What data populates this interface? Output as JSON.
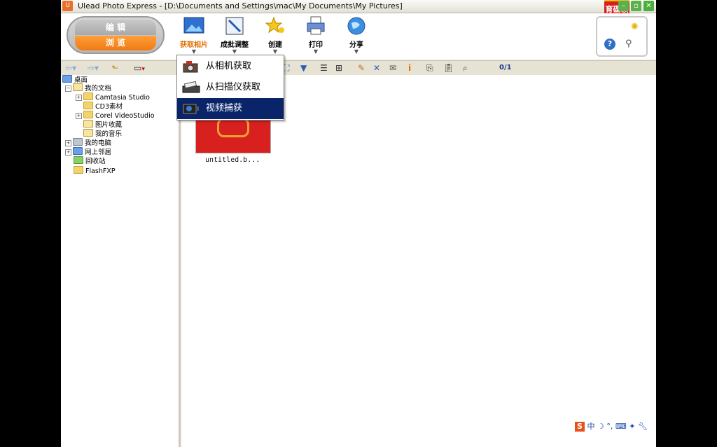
{
  "window": {
    "title": "Ulead Photo Express - [D:\\Documents and Settings\\mac\\My Documents\\My Pictures]",
    "watermark": "育碟软件"
  },
  "mode": {
    "edit": "编 辑",
    "browse": "浏 览"
  },
  "toolbar": {
    "acquire": "获取相片",
    "batch": "成批调整",
    "create": "创建",
    "print": "打印",
    "share": "分享"
  },
  "dropdown": {
    "items": [
      "从相机获取",
      "从扫描仪获取",
      "视频捕获"
    ]
  },
  "browse_bar": {
    "page_count": "0/1"
  },
  "tree": [
    "桌面",
    "我的文档",
    "Camtasia Studio",
    "CD3素材",
    "Corel VideoStudio",
    "图片收藏",
    "我的音乐",
    "我的电脑",
    "网上邻居",
    "回收站",
    "FlashFXP"
  ],
  "thumbnail": {
    "caption": "untitled.b..."
  },
  "ime": {
    "mode": "中"
  },
  "colors": {
    "accent": "#f07a12",
    "selection": "#0a246a"
  }
}
